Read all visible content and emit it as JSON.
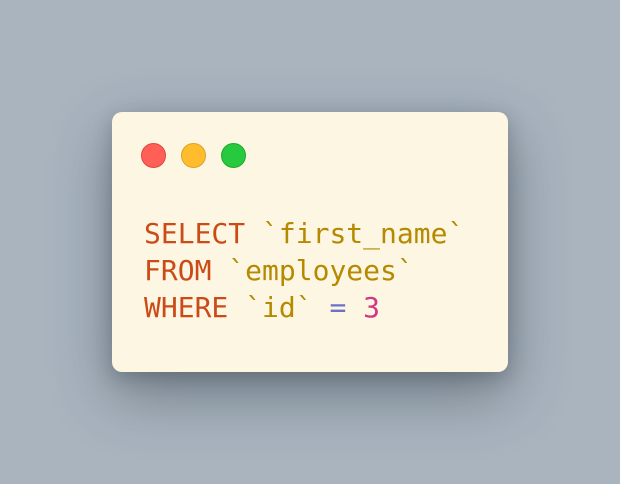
{
  "window": {
    "controls": {
      "close_color": "#ff5f56",
      "minimize_color": "#ffbd2e",
      "maximize_color": "#27c93f"
    }
  },
  "code": {
    "line1": {
      "keyword": "SELECT",
      "identifier": "`first_name`"
    },
    "line2": {
      "keyword": "FROM",
      "identifier": "`employees`"
    },
    "line3": {
      "keyword": "WHERE",
      "identifier": "`id`",
      "operator": "=",
      "value": "3"
    }
  },
  "colors": {
    "background": "#a9b4bf",
    "panel": "#fdf6e3",
    "keyword": "#cb4b16",
    "identifier": "#b58900",
    "operator": "#6c71c4",
    "number": "#d33682"
  }
}
